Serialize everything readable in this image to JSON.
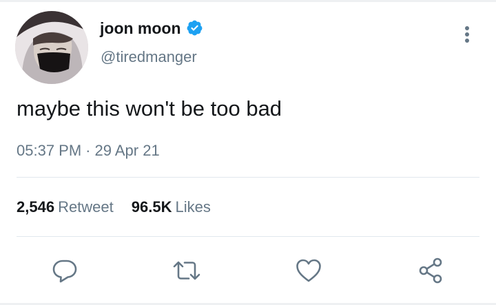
{
  "user": {
    "display_name": "joon moon",
    "handle": "@tiredmanger",
    "verified": true
  },
  "tweet": {
    "text": "maybe this won't be too bad",
    "time": "05:37 PM",
    "separator": "·",
    "date": "29 Apr 21"
  },
  "stats": {
    "retweet_count": "2,546",
    "retweet_label": "Retweet",
    "likes_count": "96.5K",
    "likes_label": "Likes"
  },
  "actions": {
    "icons": [
      "reply-icon",
      "retweet-icon",
      "like-icon",
      "share-icon"
    ]
  },
  "colors": {
    "text_primary": "#14171a",
    "text_secondary": "#657786",
    "verified_blue": "#1da1f2",
    "divider": "#e1e8ed"
  }
}
